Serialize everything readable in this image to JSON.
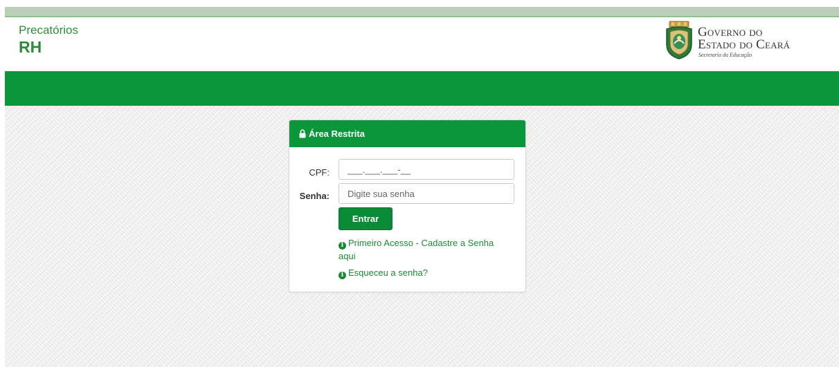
{
  "header": {
    "app_subtitle": "Precatórios",
    "app_title": "RH",
    "gov_line1": "Governo do",
    "gov_line2": "Estado do Ceará",
    "gov_line3": "Secretaria da Educação"
  },
  "login": {
    "heading": "Área Restrita",
    "cpf_label": "CPF:",
    "cpf_value": "___.___.___-__",
    "senha_label": "Senha:",
    "senha_placeholder": "Digite sua senha",
    "submit_label": "Entrar",
    "first_access_link": "Primeiro Acesso - Cadastre a Senha aqui",
    "forgot_link": "Esqueceu a senha?"
  },
  "icons": {
    "lock": "lock-icon",
    "info": "info-circle-icon",
    "crest": "ceara-crest-icon"
  },
  "colors": {
    "brand_green": "#0b963b",
    "link_green": "#1b8a36",
    "background": "#efefee"
  }
}
